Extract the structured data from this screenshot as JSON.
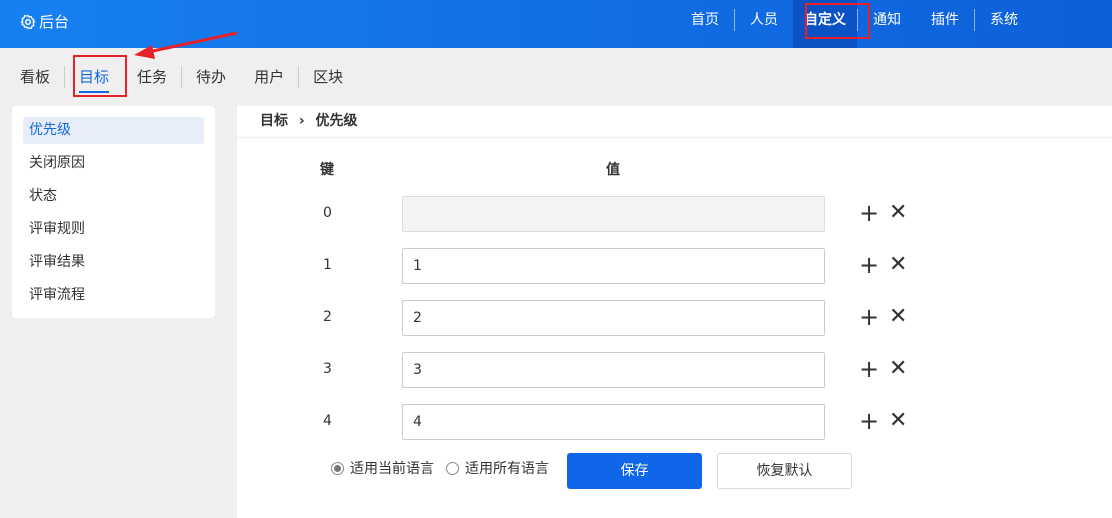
{
  "header": {
    "brand": "后台",
    "nav": [
      {
        "label": "首页"
      },
      {
        "label": "人员"
      },
      {
        "label": "自定义",
        "active": true
      },
      {
        "label": "通知"
      },
      {
        "label": "插件"
      },
      {
        "label": "系统"
      }
    ]
  },
  "subnav": [
    {
      "label": "看板"
    },
    {
      "label": "目标",
      "active": true
    },
    {
      "label": "任务"
    },
    {
      "label": "待办"
    },
    {
      "label": "用户"
    },
    {
      "label": "区块"
    }
  ],
  "sidebar": [
    {
      "label": "优先级",
      "active": true
    },
    {
      "label": "关闭原因"
    },
    {
      "label": "状态"
    },
    {
      "label": "评审规则"
    },
    {
      "label": "评审结果"
    },
    {
      "label": "评审流程"
    }
  ],
  "breadcrumb": {
    "parent": "目标",
    "sep": "›",
    "current": "优先级"
  },
  "table": {
    "key_header": "键",
    "value_header": "值",
    "rows": [
      {
        "key": "0",
        "value": ""
      },
      {
        "key": "1",
        "value": "1"
      },
      {
        "key": "2",
        "value": "2"
      },
      {
        "key": "3",
        "value": "3"
      },
      {
        "key": "4",
        "value": "4"
      }
    ]
  },
  "options": {
    "current": "适用当前语言",
    "all": "适用所有语言",
    "selected": "current"
  },
  "buttons": {
    "save": "保存",
    "reset": "恢复默认"
  },
  "colors": {
    "header": "#1680f2",
    "accent": "#0f66e8",
    "annotation": "#e8202a"
  }
}
